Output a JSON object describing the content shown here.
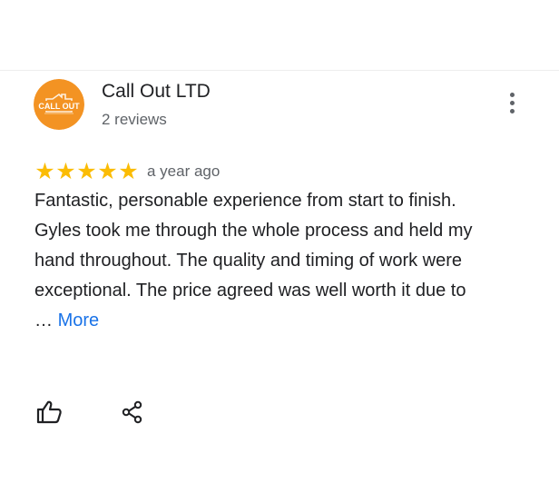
{
  "reviewer": {
    "name": "Call Out LTD",
    "meta": "2 reviews",
    "avatar_icon": "call-out-logo",
    "avatar_text": "CALL OUT",
    "avatar_color": "#f39323"
  },
  "review": {
    "rating": 5,
    "max_rating": 5,
    "stars": "★★★★★",
    "star_color": "#fbbc04",
    "time_ago": "a year ago",
    "paragraph_1": "Fantastic, personable experience from start to finish.",
    "paragraph_2": "Gyles took me through the whole process and held my hand throughout. The quality and timing of work were exceptional. The price agreed was well worth it due to … ",
    "more_label": "More",
    "link_color": "#1a73e8"
  },
  "actions": {
    "like_icon": "thumbs-up-icon",
    "share_icon": "share-icon",
    "menu_icon": "more-vert-icon"
  }
}
